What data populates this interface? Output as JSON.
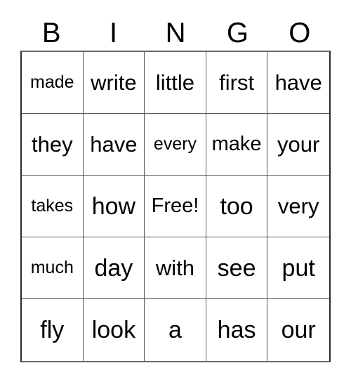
{
  "card": {
    "type": "bingo-card",
    "background_color": "#ffffff",
    "text_color": "#000000",
    "border_color": "#555555",
    "columns": 5,
    "rows": 5
  },
  "header": {
    "letters": [
      "B",
      "I",
      "N",
      "G",
      "O"
    ]
  },
  "grid": {
    "rows": [
      {
        "cells": [
          {
            "text": "made",
            "size": "sm"
          },
          {
            "text": "write",
            "size": "lg"
          },
          {
            "text": "little",
            "size": "lg"
          },
          {
            "text": "first",
            "size": "lg"
          },
          {
            "text": "have",
            "size": "lg"
          }
        ]
      },
      {
        "cells": [
          {
            "text": "they",
            "size": "lg"
          },
          {
            "text": "have",
            "size": "lg"
          },
          {
            "text": "every",
            "size": "sm"
          },
          {
            "text": "make",
            "size": "md"
          },
          {
            "text": "your",
            "size": "lg"
          }
        ]
      },
      {
        "cells": [
          {
            "text": "takes",
            "size": "sm"
          },
          {
            "text": "how",
            "size": "xl"
          },
          {
            "text": "Free!",
            "size": "md"
          },
          {
            "text": "too",
            "size": "xl"
          },
          {
            "text": "very",
            "size": "lg"
          }
        ]
      },
      {
        "cells": [
          {
            "text": "much",
            "size": "sm"
          },
          {
            "text": "day",
            "size": "xl"
          },
          {
            "text": "with",
            "size": "lg"
          },
          {
            "text": "see",
            "size": "xl"
          },
          {
            "text": "put",
            "size": "xl"
          }
        ]
      },
      {
        "cells": [
          {
            "text": "fly",
            "size": "xl"
          },
          {
            "text": "look",
            "size": "xl"
          },
          {
            "text": "a",
            "size": "xl"
          },
          {
            "text": "has",
            "size": "xl"
          },
          {
            "text": "our",
            "size": "xl"
          }
        ]
      }
    ]
  }
}
